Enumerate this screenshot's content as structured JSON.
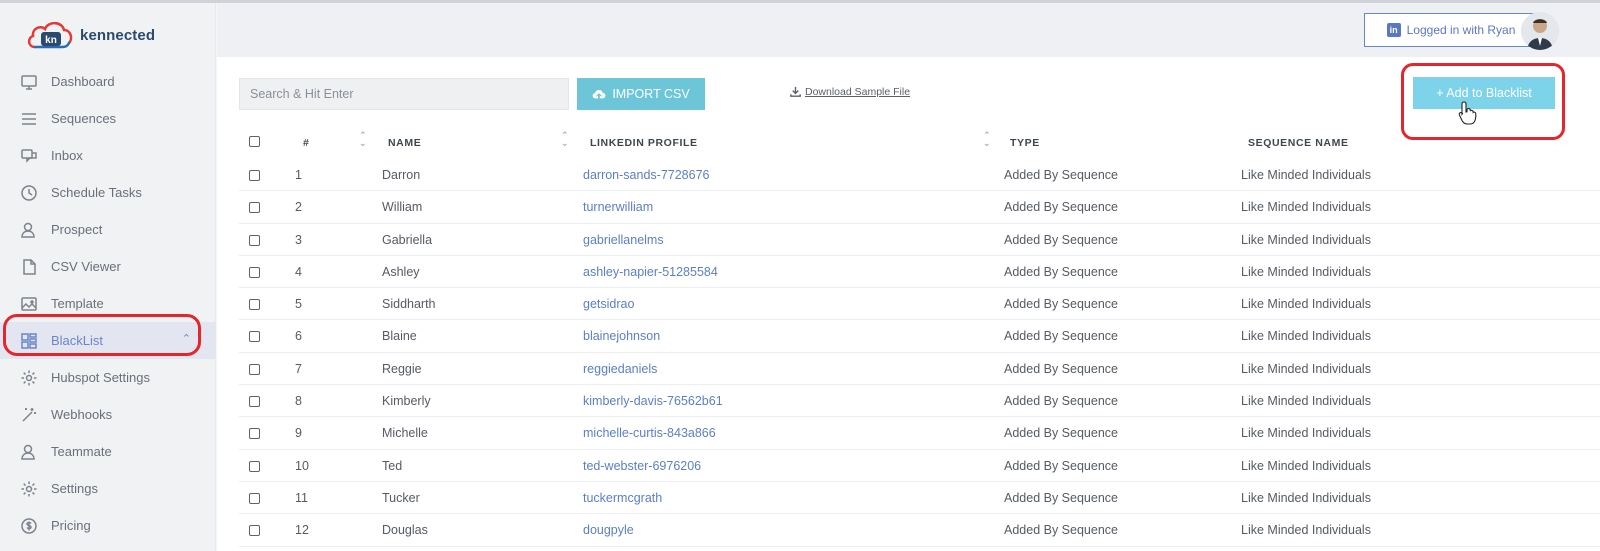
{
  "app": {
    "brand": "kennected",
    "logo_mark": "kn"
  },
  "sidebar": {
    "items": [
      {
        "label": "Dashboard",
        "icon": "monitor-icon"
      },
      {
        "label": "Sequences",
        "icon": "list-icon"
      },
      {
        "label": "Inbox",
        "icon": "chat-icon"
      },
      {
        "label": "Schedule Tasks",
        "icon": "clock-icon"
      },
      {
        "label": "Prospect",
        "icon": "user-icon"
      },
      {
        "label": "CSV Viewer",
        "icon": "file-icon"
      },
      {
        "label": "Template",
        "icon": "image-icon"
      },
      {
        "label": "BlackList",
        "icon": "layout-icon",
        "active": true
      },
      {
        "label": "Hubspot Settings",
        "icon": "gear-icon"
      },
      {
        "label": "Webhooks",
        "icon": "magic-wand-icon"
      },
      {
        "label": "Teammate",
        "icon": "user-icon"
      },
      {
        "label": "Settings",
        "icon": "gear-icon"
      },
      {
        "label": "Pricing",
        "icon": "dollar-icon"
      }
    ]
  },
  "header": {
    "login_label": "Logged in with Ryan",
    "linkedin_mark": "in"
  },
  "toolbar": {
    "search_placeholder": "Search & Hit Enter",
    "import_label": "IMPORT CSV",
    "download_label": "Download Sample File",
    "add_label": "+ Add to Blacklist"
  },
  "table": {
    "columns": {
      "num": "#",
      "name": "NAME",
      "profile": "LINKEDIN PROFILE",
      "type": "TYPE",
      "sequence": "SEQUENCE NAME"
    },
    "rows": [
      {
        "num": "1",
        "name": "Darron",
        "profile": "darron-sands-7728676",
        "type": "Added By Sequence",
        "sequence": "Like Minded Individuals"
      },
      {
        "num": "2",
        "name": "William",
        "profile": "turnerwilliam",
        "type": "Added By Sequence",
        "sequence": "Like Minded Individuals"
      },
      {
        "num": "3",
        "name": "Gabriella",
        "profile": "gabriellanelms",
        "type": "Added By Sequence",
        "sequence": "Like Minded Individuals"
      },
      {
        "num": "4",
        "name": "Ashley",
        "profile": "ashley-napier-51285584",
        "type": "Added By Sequence",
        "sequence": "Like Minded Individuals"
      },
      {
        "num": "5",
        "name": "Siddharth",
        "profile": "getsidrao",
        "type": "Added By Sequence",
        "sequence": "Like Minded Individuals"
      },
      {
        "num": "6",
        "name": "Blaine",
        "profile": "blainejohnson",
        "type": "Added By Sequence",
        "sequence": "Like Minded Individuals"
      },
      {
        "num": "7",
        "name": "Reggie",
        "profile": "reggiedaniels",
        "type": "Added By Sequence",
        "sequence": "Like Minded Individuals"
      },
      {
        "num": "8",
        "name": "Kimberly",
        "profile": "kimberly-davis-76562b61",
        "type": "Added By Sequence",
        "sequence": "Like Minded Individuals"
      },
      {
        "num": "9",
        "name": "Michelle",
        "profile": "michelle-curtis-843a866",
        "type": "Added By Sequence",
        "sequence": "Like Minded Individuals"
      },
      {
        "num": "10",
        "name": "Ted",
        "profile": "ted-webster-6976206",
        "type": "Added By Sequence",
        "sequence": "Like Minded Individuals"
      },
      {
        "num": "11",
        "name": "Tucker",
        "profile": "tuckermcgrath",
        "type": "Added By Sequence",
        "sequence": "Like Minded Individuals"
      },
      {
        "num": "12",
        "name": "Douglas",
        "profile": "dougpyle",
        "type": "Added By Sequence",
        "sequence": "Like Minded Individuals"
      }
    ]
  },
  "colors": {
    "accent": "#6a86c9",
    "import_button": "#6cc6d8",
    "add_button": "#7dd3ea",
    "highlight": "#e3262c",
    "link": "#5b7fc6"
  }
}
